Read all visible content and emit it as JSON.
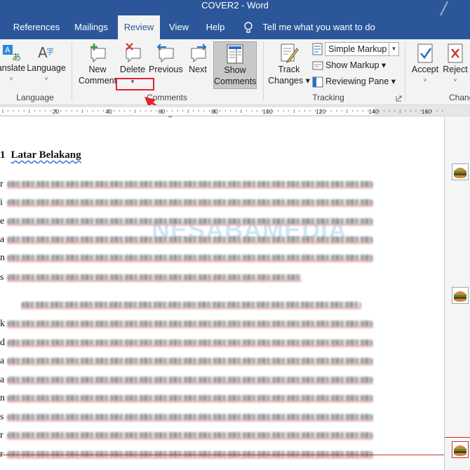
{
  "window": {
    "title": "COVER2  -  Word"
  },
  "tabs": [
    {
      "label": "References",
      "active": false
    },
    {
      "label": "Mailings",
      "active": false
    },
    {
      "label": "Review",
      "active": true
    },
    {
      "label": "View",
      "active": false
    },
    {
      "label": "Help",
      "active": false
    }
  ],
  "tell_me": {
    "placeholder": "Tell me what you want to do"
  },
  "ribbon": {
    "language": {
      "translate": {
        "line1": "anslate",
        "line2": "˅"
      },
      "language": {
        "line1": "Language",
        "line2": "˅"
      },
      "group_label": "Language"
    },
    "comments": {
      "new": {
        "line1": "New",
        "line2": "Comment"
      },
      "delete": {
        "line1": "Delete",
        "line2": "▾"
      },
      "previous": {
        "line1": "Previous"
      },
      "next": {
        "line1": "Next"
      },
      "show": {
        "line1": "Show",
        "line2": "Comments"
      },
      "group_label": "Comments"
    },
    "tracking": {
      "track": {
        "line1": "Track",
        "line2": "Changes ▾"
      },
      "markup_select": "Simple Markup",
      "show_markup": "Show Markup ▾",
      "reviewing_pane": "Reviewing Pane ▾",
      "group_label": "Tracking"
    },
    "changes": {
      "accept": {
        "line1": "Accept",
        "line2": "˅"
      },
      "reject": {
        "line1": "Reject",
        "line2": "˅"
      },
      "group_label": "Chang"
    }
  },
  "ruler": {
    "labels": [
      "20",
      "40",
      "60",
      "80",
      "100",
      "120",
      "140",
      "160"
    ]
  },
  "document": {
    "heading_number": "1",
    "heading": "Latar Belakang",
    "watermark": "NESABAMEDIA",
    "line_initials": [
      "r",
      "i",
      "e",
      "a",
      "n",
      "s",
      "",
      "k",
      "d",
      "a",
      "a",
      "n",
      "s",
      "r",
      "r"
    ]
  },
  "colors": {
    "accent": "#2b579a",
    "annotation": "#e0232c",
    "ribbon_bg": "#f3f3f3"
  }
}
